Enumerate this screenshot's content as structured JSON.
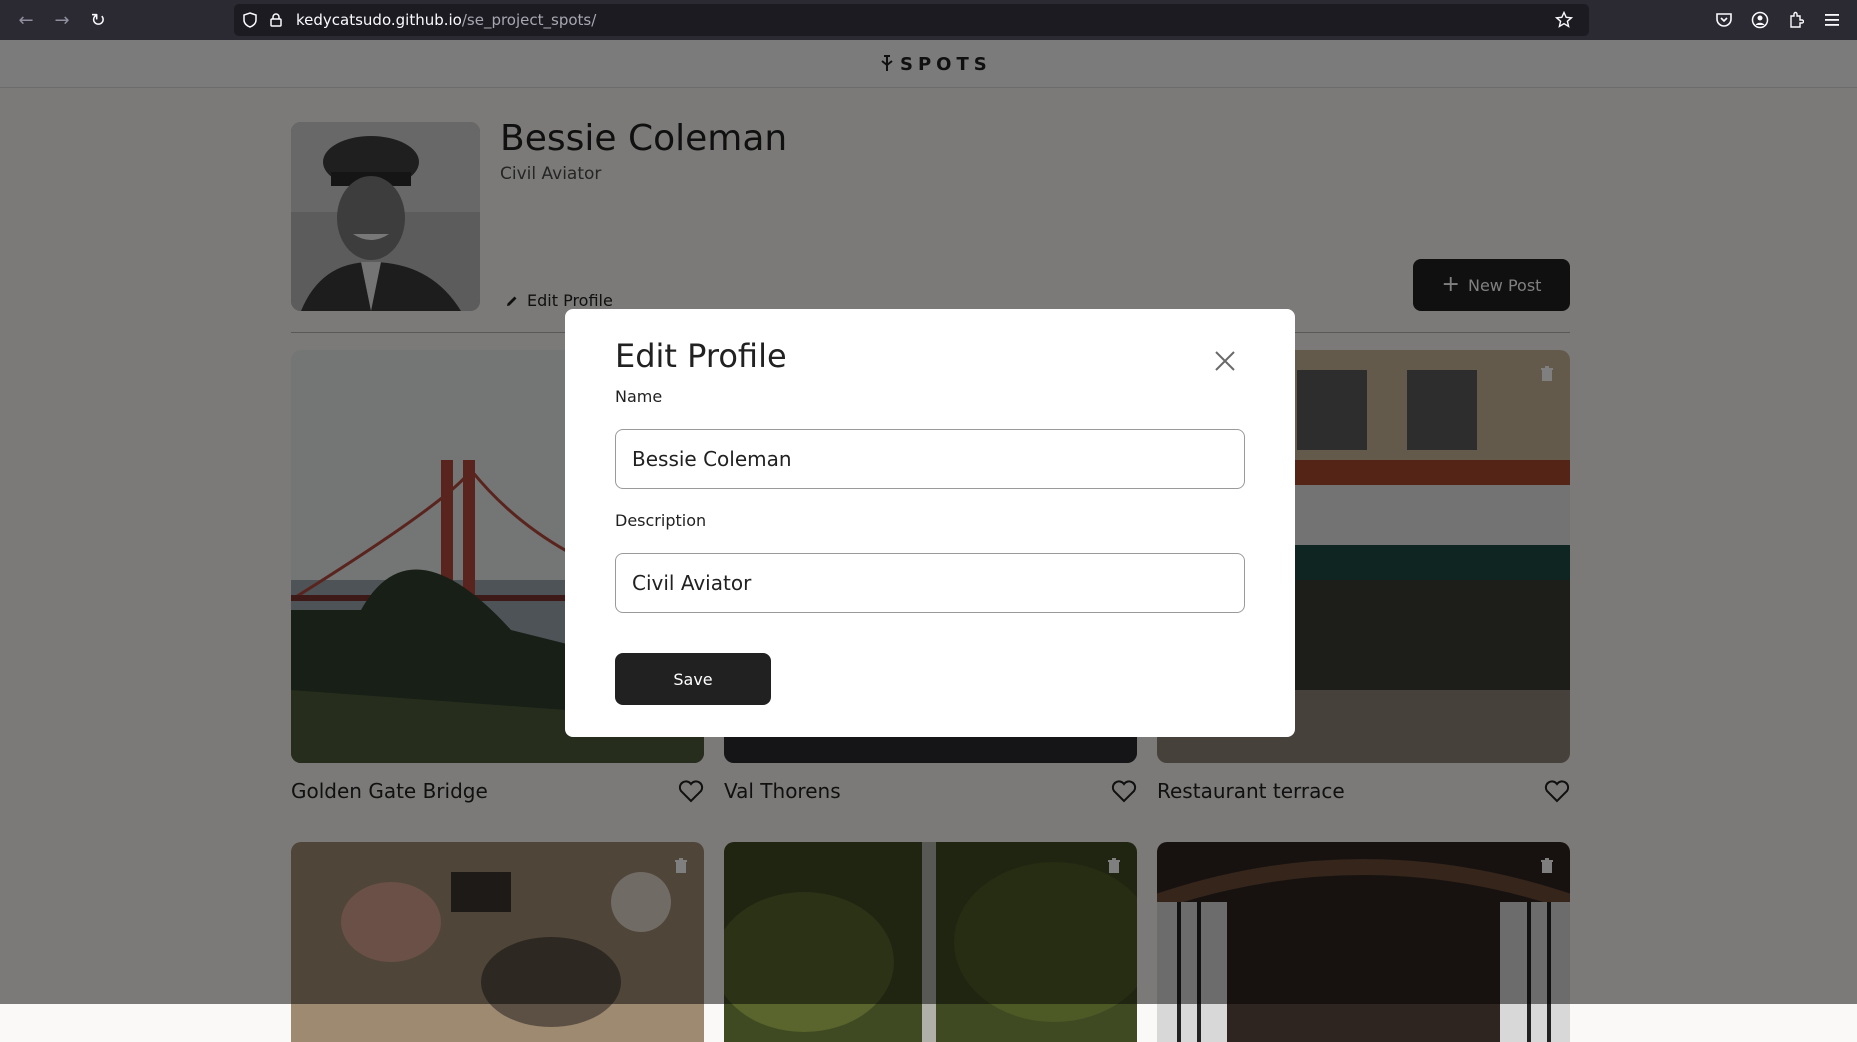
{
  "browser": {
    "url_host": "kedycatsudo.github.io",
    "url_path": "/se_project_spots/",
    "icons": [
      "back-arrow-icon",
      "forward-arrow-icon",
      "reload-icon",
      "shield-icon",
      "lock-icon",
      "bookmark-star-icon",
      "pocket-icon",
      "account-icon",
      "extensions-icon",
      "menu-icon"
    ]
  },
  "header": {
    "logo_text": "SPOTS"
  },
  "profile": {
    "name": "Bessie Coleman",
    "description": "Civil Aviator",
    "edit_label": "Edit Profile",
    "new_post_label": "New Post"
  },
  "cards": [
    {
      "title": "Golden Gate Bridge"
    },
    {
      "title": "Val Thorens"
    },
    {
      "title": "Restaurant terrace"
    },
    {
      "title": ""
    },
    {
      "title": ""
    },
    {
      "title": ""
    }
  ],
  "modal": {
    "title": "Edit Profile",
    "name_label": "Name",
    "name_value": "Bessie Coleman",
    "description_label": "Description",
    "description_value": "Civil Aviator",
    "save_label": "Save"
  },
  "colors": {
    "overlay": "rgba(0,0,0,0.5)",
    "button": "#212121"
  }
}
